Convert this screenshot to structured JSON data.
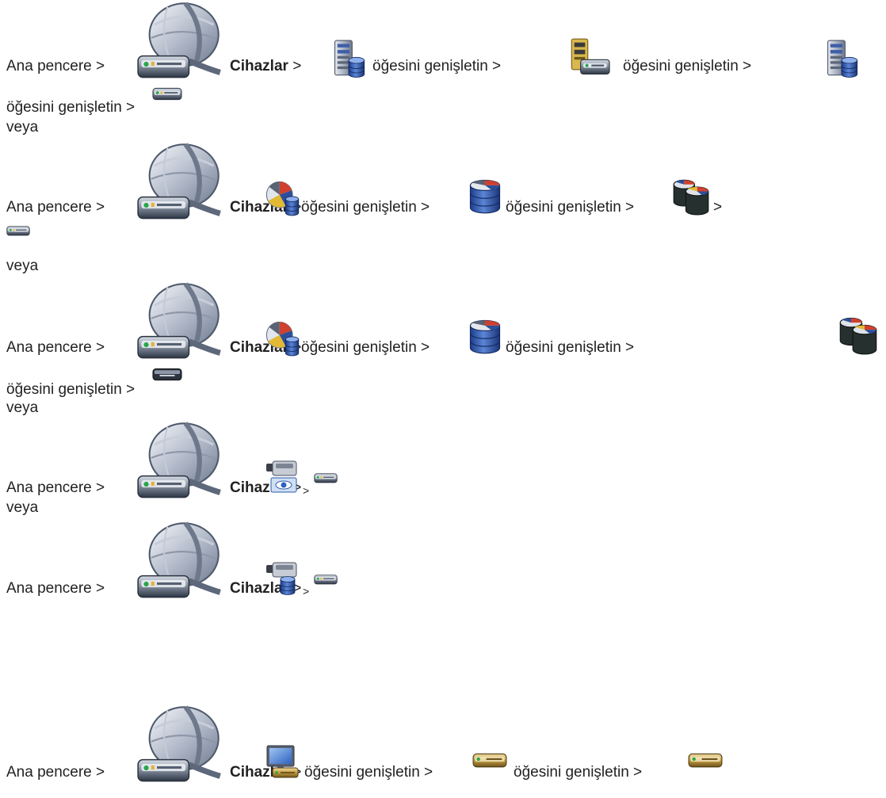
{
  "s": {
    "ana": "Ana pencere",
    "sep": ">",
    "cihazlar": "Cihazlar",
    "exp": "öğesini genişletin",
    "veya": "veya"
  },
  "icons": {
    "devices": "devices-globe-network-icon",
    "server": "server-rack-icon",
    "device_server": "device-server-icon",
    "encoder": "encoder-box-icon",
    "vrm_pie_db": "vrm-pie-database-icon",
    "db_pie": "database-pie-icon",
    "dual_db_pie": "dual-database-pie-icon",
    "decoder_dark": "decoder-box-icon",
    "camera_eye": "camera-eye-icon",
    "camera_db": "camera-database-icon",
    "monitor_device": "monitor-device-icon",
    "encoder_gold": "encoder-box-gold-icon"
  }
}
